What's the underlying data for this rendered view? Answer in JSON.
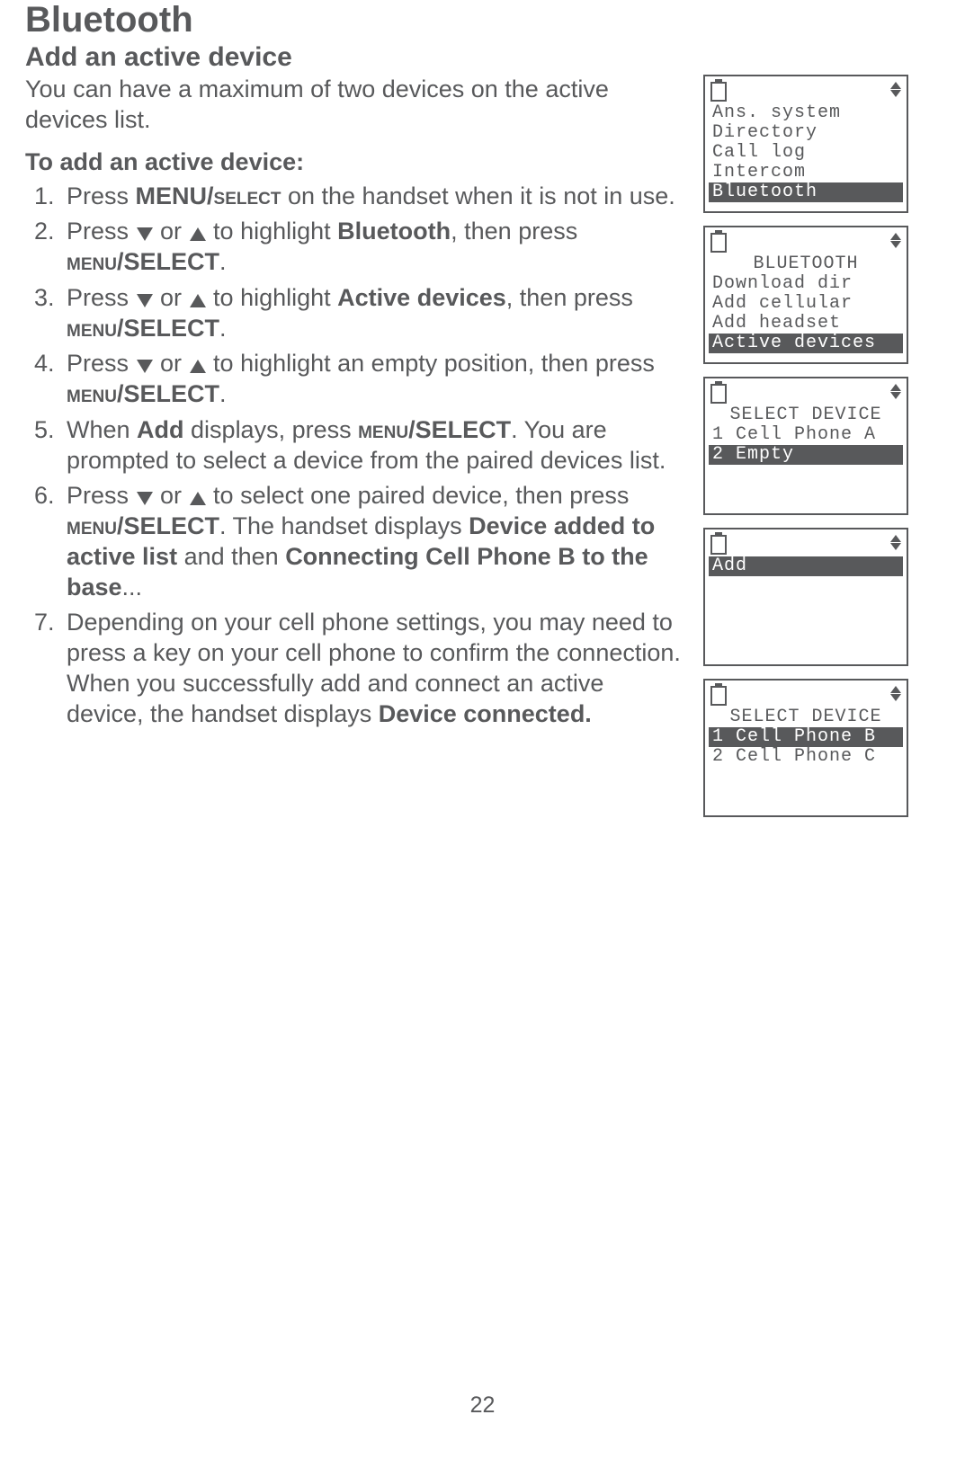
{
  "title": "Bluetooth",
  "subtitle": "Add an active device",
  "intro": "You can have a maximum of two devices on the active devices list.",
  "leadin": "To add an active device:",
  "pageNumber": "22",
  "steps": {
    "s1a": "Press ",
    "s1b": "MENU/",
    "s1c": "select",
    "s1d": " on the handset when it is not in use.",
    "s2a": "Press ",
    "s2b": " or ",
    "s2c": " to highlight ",
    "s2d": "Bluetooth",
    "s2e": ", then press ",
    "s2f": "menu",
    "s2g": "/SELECT",
    "s3a": "Press ",
    "s3b": " or ",
    "s3c": " to highlight ",
    "s3d": "Active devices",
    "s3e": ", then press ",
    "s3f": "menu",
    "s3g": "/SELECT",
    "s4a": "Press ",
    "s4b": " or ",
    "s4c": " to highlight an empty position, then press ",
    "s4f": "menu",
    "s4g": "/SELECT",
    "s5a": "When ",
    "s5b": "Add",
    "s5c": " displays, press ",
    "s5f": "menu",
    "s5g": "/SELECT",
    "s5h": ". You are prompted to select a device from the paired devices list.",
    "s6a": "Press ",
    "s6b": " or ",
    "s6c": " to select one paired device, then press ",
    "s6f": "menu",
    "s6g": "/SELECT",
    "s6h": ". The handset displays ",
    "s6i": "Device added to active list",
    "s6j": " and then ",
    "s6k": "Connecting Cell Phone B to the base",
    "s6l": "...",
    "s7a": "Depending on your cell phone settings, you may need to press a key on your cell phone to confirm the connection. When you successfully add and connect an active device, the handset displays ",
    "s7b": "Device connected."
  },
  "screens": [
    {
      "rows": [
        {
          "text": "Ans. system",
          "hl": false
        },
        {
          "text": "Directory",
          "hl": false
        },
        {
          "text": "Call log",
          "hl": false
        },
        {
          "text": "Intercom",
          "hl": false
        },
        {
          "text": "Bluetooth",
          "hl": true
        }
      ]
    },
    {
      "rows": [
        {
          "text": "BLUETOOTH",
          "hl": false,
          "center": true
        },
        {
          "text": "Download dir",
          "hl": false
        },
        {
          "text": "Add cellular",
          "hl": false
        },
        {
          "text": "Add headset",
          "hl": false
        },
        {
          "text": "Active devices",
          "hl": true
        }
      ]
    },
    {
      "rows": [
        {
          "text": "SELECT DEVICE",
          "hl": false,
          "center": true
        },
        {
          "text": "1 Cell Phone A",
          "hl": false
        },
        {
          "text": "2 Empty",
          "hl": true
        },
        {
          "text": " ",
          "hl": false
        },
        {
          "text": " ",
          "hl": false
        }
      ]
    },
    {
      "rows": [
        {
          "text": "Add",
          "hl": true
        },
        {
          "text": " ",
          "hl": false
        },
        {
          "text": " ",
          "hl": false
        },
        {
          "text": " ",
          "hl": false
        },
        {
          "text": " ",
          "hl": false
        }
      ]
    },
    {
      "rows": [
        {
          "text": "SELECT DEVICE",
          "hl": false,
          "center": true
        },
        {
          "text": "1 Cell Phone B",
          "hl": true
        },
        {
          "text": "2 Cell Phone C",
          "hl": false
        },
        {
          "text": " ",
          "hl": false
        },
        {
          "text": " ",
          "hl": false
        }
      ]
    }
  ]
}
